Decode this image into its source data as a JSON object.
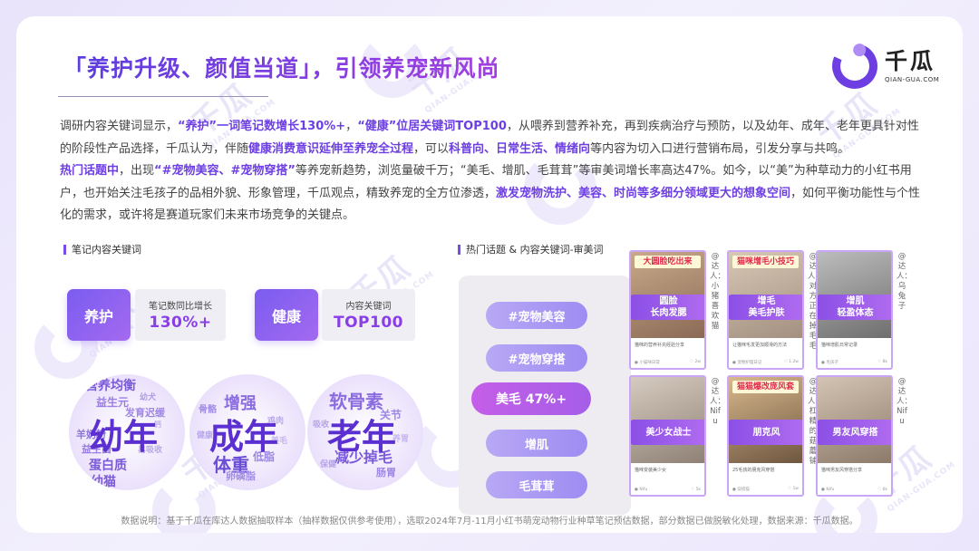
{
  "title": "「养护升级、颜值当道」，引领养宠新风尚",
  "logo": {
    "cn": "千瓜",
    "en": "QIAN-GUA.COM"
  },
  "watermark": {
    "cn": "千瓜",
    "en": "QIAN-GUA.COM"
  },
  "paragraph": [
    {
      "t": "调研内容关键词显示，",
      "h": false
    },
    {
      "t": "“养护”一词笔记数增长130%+",
      "h": true
    },
    {
      "t": "，",
      "h": false
    },
    {
      "t": "“健康”位居关键词TOP100",
      "h": true
    },
    {
      "t": "，从喂养到营养补充，再到疾病治疗与预防，以及幼年、成年、老年更具针对性的阶段性产品选择，千瓜认为，伴随",
      "h": false
    },
    {
      "t": "健康消费意识延伸至养宠全过程",
      "h": true
    },
    {
      "t": "，可以",
      "h": false
    },
    {
      "t": "科普向、日常生活、情绪向",
      "h": true
    },
    {
      "t": "等内容为切入口进行营销布局，引发分享与共鸣。",
      "h": false
    },
    {
      "t": "\n",
      "h": false
    },
    {
      "t": "热门话题中",
      "h": true
    },
    {
      "t": "，出现",
      "h": false
    },
    {
      "t": "“#宠物美容、#宠物穿搭”",
      "h": true
    },
    {
      "t": "等养宠新趋势，浏览量破千万；“美毛、增肌、毛茸茸”等审美词增长率高达47%。如今，以“美”为种草动力的小红书用户，也开始关注毛孩子的品相外貌、形象管理，千瓜观点，精致养宠的全方位渗透，",
      "h": false
    },
    {
      "t": "激发宠物洗护、美容、时尚等多细分领域更大的想象空间",
      "h": true
    },
    {
      "t": "，如何平衡功能性与个性化的需求，或许将是赛道玩家们未来市场竞争的关键点。",
      "h": false
    }
  ],
  "left_section": {
    "label": "笔记内容关键词",
    "cards": [
      {
        "keyword": "养护",
        "stat_label": "笔记数同比增长",
        "stat_value": "130%+"
      },
      {
        "keyword": "健康",
        "stat_label": "内容关键词",
        "stat_value": "TOP100"
      }
    ],
    "clouds": [
      {
        "main": "幼年",
        "words": [
          "营养均衡",
          "益生元",
          "幼犬",
          "发育迟缓",
          "羊奶粉",
          "蛋白质",
          "益生菌",
          "易吸收",
          "钙",
          "幼猫"
        ]
      },
      {
        "main": "成年",
        "words": [
          "增强",
          "骨骼",
          "体重",
          "低脂",
          "卵磷脂",
          "鸡肉",
          "健康",
          "美毛"
        ]
      },
      {
        "main": "老年",
        "words": [
          "软骨素",
          "关节",
          "减少掉毛",
          "肠胃",
          "吸收",
          "保健",
          "养胃"
        ]
      }
    ]
  },
  "right_section": {
    "label": "热门话题 & 内容关键词-审美词",
    "topics": [
      "#宠物美容",
      "#宠物穿搭",
      "美毛 47%+",
      "增肌",
      "毛茸茸"
    ],
    "posts": [
      {
        "badge": "圆脸\n长肉发腮",
        "banner": "大圆脸吃出来",
        "caption": "猫咪的营养补充经验分享",
        "user": "小猫咪日常",
        "likes": "2w",
        "author": "@达人：小猪喜欢猫"
      },
      {
        "badge": "增毛\n美毛护肤",
        "banner": "猫咪增毛小技巧",
        "caption": "让猫咪毛发更加顺滑的方法",
        "user": "宠物护理日记",
        "likes": "1.2w",
        "author": "@达人：对方正在掉毛毛"
      },
      {
        "badge": "增肌\n轻盈体态",
        "banner": "",
        "caption": "猫咪增肌日常记录",
        "user": "毛孩子",
        "likes": "8k",
        "author": "@达人：乌兔子"
      },
      {
        "badge": "美少女战士",
        "banner": "",
        "caption": "猫咪变装美少女",
        "user": "Nifu",
        "likes": "5k",
        "author": "@达人：Nifu"
      },
      {
        "badge": "朋克风",
        "banner": "猫猫爆改庞风套",
        "caption": "25毛孩的朋克风穿搭",
        "user": "穿搭猫",
        "likes": "1w",
        "author": "@达人：杠精的菇蘑铺"
      },
      {
        "badge": "男友风穿搭",
        "banner": "",
        "caption": "猫咪男友风穿搭分享",
        "user": "Nifu",
        "likes": "6k",
        "author": "@达人：Nifu"
      }
    ]
  },
  "footnote": "数据说明：基于千瓜在库达人数据抽取样本（抽样数据仅供参考使用），选取2024年7月-11月小红书萌宠动物行业种草笔记预估数据，部分数据已做脱敏化处理，数据来源：千瓜数据。",
  "colors": {
    "accent": "#6d3fe3",
    "pill": "#a08cf2",
    "highlight_pill": "#c05fe8"
  }
}
